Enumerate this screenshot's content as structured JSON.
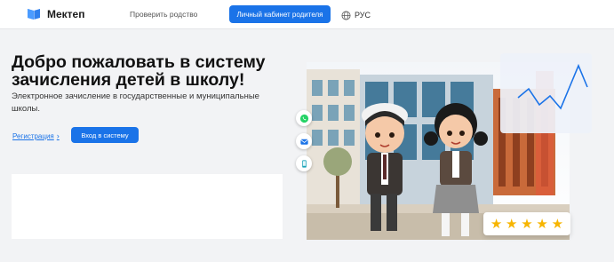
{
  "header": {
    "logo_text": "Мектеп",
    "logo_icon": "book-icon",
    "check_relationship_label": "Проверить родство",
    "cabinet_button_label": "Личный кабинет родителя",
    "language_icon": "globe-icon",
    "language_label": "РУС"
  },
  "hero": {
    "title": "Добро пожаловать в систему зачисления детей в школу!",
    "subtitle": "Электронное зачисление в государственные и муниципальные школы.",
    "register_link_label": "Регистрация",
    "login_button_label": "Вход в систему"
  },
  "illustration": {
    "side_icons": [
      "whatsapp-icon",
      "email-icon",
      "phone-icon"
    ],
    "rating_stars": 5,
    "colors": {
      "accent": "#1a73e8",
      "whatsapp": "#25d366",
      "star": "#f7b500"
    }
  }
}
